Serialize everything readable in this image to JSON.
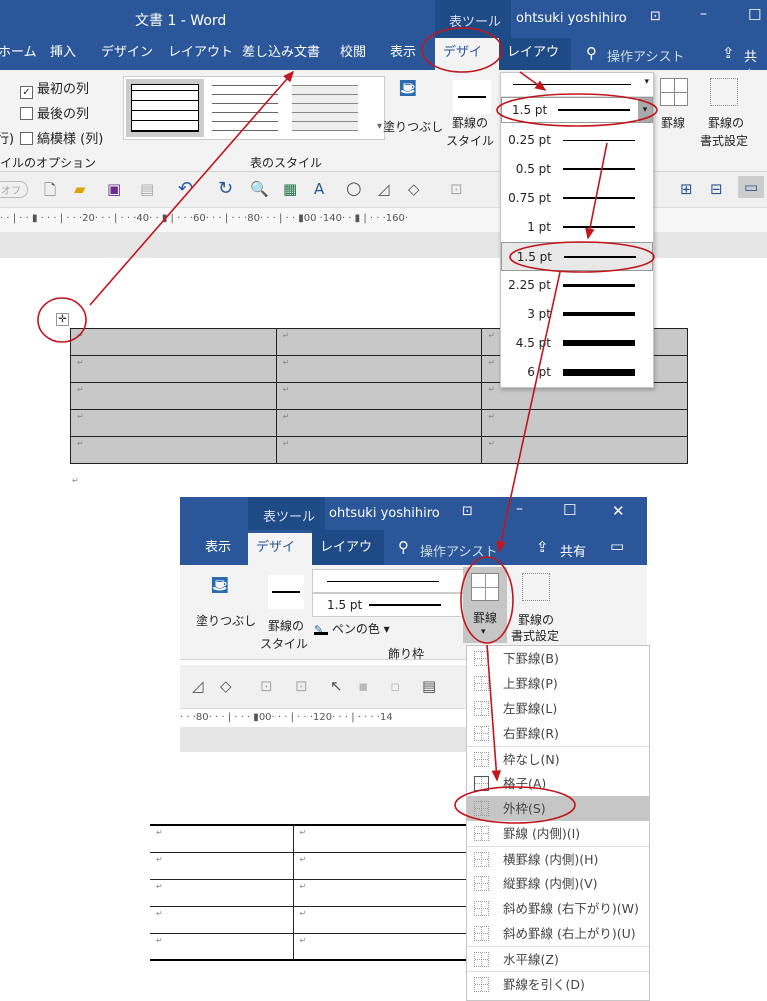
{
  "window1": {
    "title": "文書 1  -  Word",
    "context_tab": "表ツール",
    "user": "ohtsuki yoshihiro",
    "tabs": [
      "ホーム",
      "挿入",
      "デザイン",
      "レイアウト",
      "差し込み文書",
      "校閲",
      "表示",
      "デザイン",
      "レイアウト"
    ],
    "active_tab": "デザイン",
    "assist": "操作アシスト",
    "share": "共有",
    "options": [
      {
        "label": "最初の列",
        "checked": true
      },
      {
        "label": "最後の列",
        "checked": false
      },
      {
        "label": "縞模様 (列)",
        "checked": false
      }
    ],
    "options_left": "行)",
    "options_group": "イルのオプション",
    "styles_group": "表のスタイル",
    "fill": "塗りつぶし",
    "border_style": "罫線の",
    "border_style2": "スタイル",
    "width_value": "1.5 pt",
    "borders": "罫線",
    "border_format": "罫線の",
    "border_format2": "書式設定",
    "toggle": "オフ",
    "ruler": "· · | · · ▮  · · · | · · ·20· · · | · · ·40· · ▮ | · · ·60· · · | · · ·80· · · | · · ▮00     ·140· · ▮ | · · ·160·"
  },
  "width_dropdown": {
    "items": [
      "0.25 pt",
      "0.5 pt",
      "0.75 pt",
      "1 pt",
      "1.5 pt",
      "2.25 pt",
      "3 pt",
      "4.5 pt",
      "6 pt"
    ],
    "selected": "1.5 pt"
  },
  "table": {
    "rows": 5,
    "cols": 3,
    "cell_mark": "↵",
    "fill": "#c8c8c8"
  },
  "window2": {
    "context_tab": "表ツール",
    "user": "ohtsuki yoshihiro",
    "tabs": [
      "表示",
      "デザイン",
      "レイアウト"
    ],
    "assist": "操作アシスト",
    "share": "共有",
    "fill": "塗りつぶし",
    "border_style": "罫線の",
    "border_style2": "スタイル",
    "width_value": "1.5 pt",
    "pen_color": "ペンの色",
    "group": "飾り枠",
    "borders": "罫線",
    "border_format": "罫線の",
    "border_format2": "書式設定",
    "ruler": "· · ·80· · · | · · · ▮00· · · | · · ·120· · · | · · · ·14"
  },
  "borders_menu": {
    "items": [
      "下罫線(B)",
      "上罫線(P)",
      "左罫線(L)",
      "右罫線(R)",
      "枠なし(N)",
      "格子(A)",
      "外枠(S)",
      "罫線 (内側)(I)",
      "横罫線 (内側)(H)",
      "縦罫線 (内側)(V)",
      "斜め罫線 (右下がり)(W)",
      "斜め罫線 (右上がり)(U)",
      "水平線(Z)",
      "罫線を引く(D)"
    ],
    "selected": "外枠(S)"
  },
  "colors": {
    "title_bar": "#2b579a",
    "annotation": "#c0161c",
    "selection": "#c6c6c6"
  }
}
